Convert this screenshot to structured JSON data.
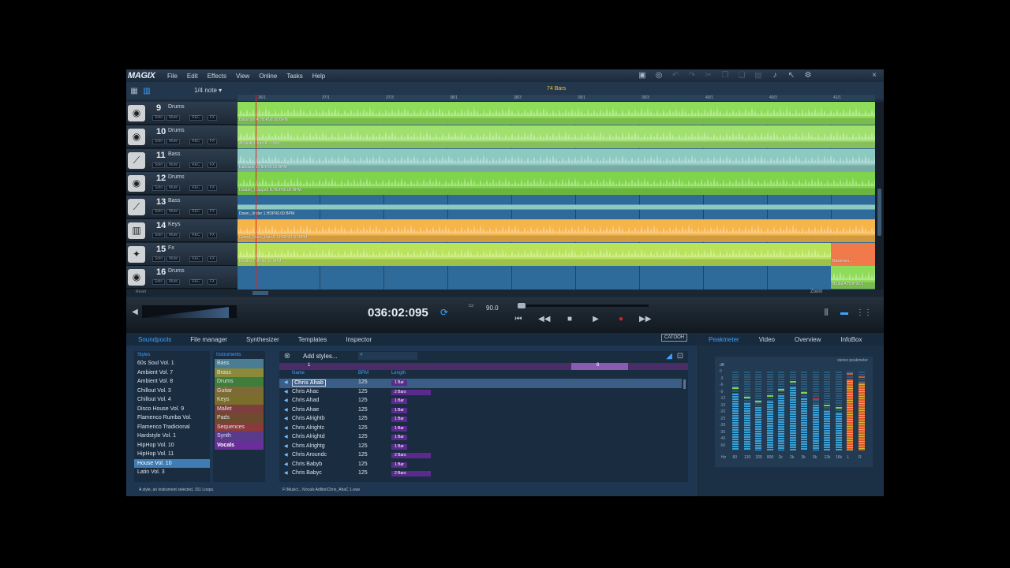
{
  "app": {
    "logo": "MAGIX"
  },
  "menu": [
    "File",
    "Edit",
    "Effects",
    "View",
    "Online",
    "Tasks",
    "Help"
  ],
  "arranger": {
    "grid": "1/4 note",
    "bars_total": "74 Bars",
    "ruler": [
      "36/1",
      "37/1",
      "37/3",
      "38/1",
      "38/3",
      "39/1",
      "39/3",
      "40/1",
      "40/3",
      "41/1"
    ],
    "tracks": [
      {
        "num": "9",
        "name": "Drums",
        "icon": "drum-icon"
      },
      {
        "num": "10",
        "name": "Drums",
        "icon": "drum-icon"
      },
      {
        "num": "11",
        "name": "Bass",
        "icon": "guitar-icon"
      },
      {
        "num": "12",
        "name": "Drums",
        "icon": "drum-icon"
      },
      {
        "num": "13",
        "name": "Bass",
        "icon": "guitar-icon"
      },
      {
        "num": "14",
        "name": "Keys",
        "icon": "keyboard-icon"
      },
      {
        "num": "15",
        "name": "Fx",
        "icon": "fx-icon"
      },
      {
        "num": "16",
        "name": "Drums",
        "icon": "drum-icon"
      }
    ],
    "track_buttons": {
      "solo": "Solo",
      "mute": "Mute",
      "rec": "REC",
      "fx": "FX"
    },
    "clips": [
      {
        "label": "BassTom A.HDP90.00 BPM",
        "color": "#8fdc5a"
      },
      {
        "label": "AcousticDrum A -->Vito",
        "color": "#9fe06e"
      },
      {
        "label": "Darkside 1.HDP90.00 BPM",
        "color": "#8cc9c0"
      },
      {
        "label": "Double_Clapped B.HDP90.00 BPM",
        "color": "#7fd44c"
      },
      {
        "label": "Down_Under 1.HDP90.00 BPM",
        "color": "#8cc9c0"
      },
      {
        "label": "Grand_Stacc_Part A 1.HDP90.00 BPM",
        "color": "#f6b54a"
      },
      {
        "label": "Beatles.HDP90.00 BPM",
        "color": "#b9e35a"
      },
      {
        "label": "Brutal A.HDP90.0",
        "color": "#8fdc5a"
      }
    ],
    "fx_clip_label": "Basemen...",
    "reset": "Reset",
    "zoom": "Zoom"
  },
  "transport": {
    "time": "036:02:095",
    "tempo": "90.0"
  },
  "pool": {
    "tabs": [
      "Soundpools",
      "File manager",
      "Synthesizer",
      "Templates",
      "Inspector"
    ],
    "catooh": "CATOOH",
    "styles_header": "Styles",
    "styles": [
      "60s Soul Vol. 1",
      "Ambient Vol. 7",
      "Ambient Vol. 8",
      "Chillout Vol. 3",
      "Chillout Vol. 4",
      "Disco House Vol. 9",
      "Flamenco Rumba Vol.",
      "Flamenco Tradicional",
      "Hardstyle Vol. 1",
      "HipHop Vol. 10",
      "HipHop Vol. 11",
      "House Vol. 10",
      "Latin Vol. 3"
    ],
    "instruments_header": "Instruments",
    "instruments": [
      {
        "name": "Bass",
        "color": "#4a7d94"
      },
      {
        "name": "Brass",
        "color": "#8a8a3a"
      },
      {
        "name": "Drums",
        "color": "#3f7d3a"
      },
      {
        "name": "Guitar",
        "color": "#7d6a36"
      },
      {
        "name": "Keys",
        "color": "#7a6e2a"
      },
      {
        "name": "Mallet",
        "color": "#7d3e3e"
      },
      {
        "name": "Pads",
        "color": "#6e4a2e"
      },
      {
        "name": "Sequences",
        "color": "#8a3a3a"
      },
      {
        "name": "Synth",
        "color": "#5a3a8a"
      },
      {
        "name": "Vocals",
        "color": "#6a2d9a"
      }
    ],
    "add_styles": "Add styles...",
    "strip": [
      "1",
      "6"
    ],
    "loop_headers": {
      "name": "Name",
      "bpm": "BPM",
      "length": "Length"
    },
    "loops": [
      {
        "name": "Chris Ahab",
        "bpm": "125",
        "length": "1 Bar"
      },
      {
        "name": "Chris Ahac",
        "bpm": "125",
        "length": "2 Bars"
      },
      {
        "name": "Chris Ahad",
        "bpm": "125",
        "length": "1 Bar"
      },
      {
        "name": "Chris Ahae",
        "bpm": "125",
        "length": "1 Bar"
      },
      {
        "name": "Chris Alrightb",
        "bpm": "125",
        "length": "1 Bar"
      },
      {
        "name": "Chris Alrightc",
        "bpm": "125",
        "length": "1 Bar"
      },
      {
        "name": "Chris Alrightd",
        "bpm": "125",
        "length": "1 Bar"
      },
      {
        "name": "Chris Alrightg",
        "bpm": "125",
        "length": "1 Bar"
      },
      {
        "name": "Chris Aroundc",
        "bpm": "125",
        "length": "2 Bars"
      },
      {
        "name": "Chris Babyb",
        "bpm": "125",
        "length": "1 Bar"
      },
      {
        "name": "Chris Babyc",
        "bpm": "125",
        "length": "2 Bars"
      }
    ],
    "status": "A style, an instrument selected, 151 Loops.",
    "path": "F:\\Music\\...\\Vocals Adlibs\\Chris_AhaC 1.wav"
  },
  "right_panel": {
    "tabs": [
      "Peakmeter",
      "Video",
      "Overview",
      "InfoBox"
    ],
    "title": "stereo peakmeter",
    "db_label": "dB",
    "db_ticks": [
      "0",
      "-3",
      "-6",
      "-9",
      "-12",
      "-15",
      "-20",
      "-25",
      "-30",
      "-35",
      "-40",
      "-50"
    ],
    "freqs": [
      "Hz",
      "60",
      "120",
      "320",
      "800",
      "1k",
      "2k",
      "3k",
      "5k",
      "12k",
      "16k",
      "L",
      "R"
    ],
    "levels": [
      0.72,
      0.6,
      0.55,
      0.62,
      0.7,
      0.8,
      0.66,
      0.58,
      0.5,
      0.47,
      0.9,
      0.86
    ]
  }
}
